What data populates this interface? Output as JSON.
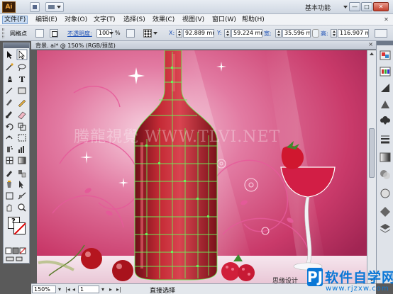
{
  "app": {
    "logo": "Ai",
    "workspace": "基本功能"
  },
  "window_controls": {
    "minimize": "—",
    "maximize": "□",
    "close": "✕"
  },
  "menus": [
    "文件(F)",
    "编辑(E)",
    "对象(O)",
    "文字(T)",
    "选择(S)",
    "效果(C)",
    "视图(V)",
    "窗口(W)",
    "帮助(H)"
  ],
  "control_bar": {
    "anchor_label": "网格点",
    "opacity_label": "不透明度:",
    "opacity_value": "100",
    "opacity_unit": "%",
    "x_label": "X:",
    "x_value": "92.889 mm",
    "y_label": "Y:",
    "y_value": "59.224 mm",
    "w_label": "宽:",
    "w_value": "35.596 mm",
    "h_label": "高:",
    "h_value": "116.907 mr"
  },
  "document": {
    "tab_title": "背景. ai* @ 150% (RGB/预览)",
    "close": "×"
  },
  "status": {
    "zoom": "150%",
    "page": "1",
    "tool": "直接选择"
  },
  "watermark": {
    "center": "腾龍視覺 WWW.TLVI.NET",
    "site_text": "思缘设计",
    "logo_letter": "PJ",
    "logo_text": "软件自学网",
    "logo_url": "www.rjzxw.com"
  },
  "colors": {
    "accent": "#1b4fb5",
    "canvas_bg": "#c93a6a",
    "bottle": "#b4202a",
    "selection": "#6cf05a"
  }
}
